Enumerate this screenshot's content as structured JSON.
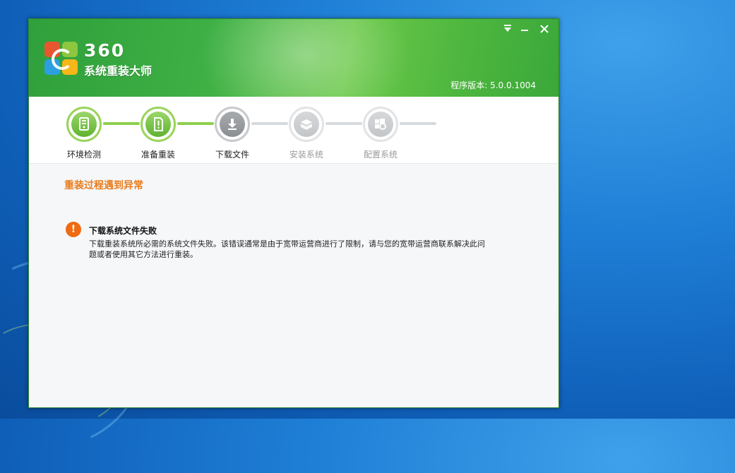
{
  "app": {
    "brand_number": "360",
    "brand_name": "系统重装大师",
    "version": "程序版本: 5.0.0.1004"
  },
  "window_controls": {
    "menu_icon": "dropdown-menu-icon",
    "minimize_icon": "minimize-icon",
    "close_icon": "close-icon"
  },
  "steps": [
    {
      "label": "环境检测",
      "icon": "computer-check-icon",
      "state": "done"
    },
    {
      "label": "准备重装",
      "icon": "prepare-icon",
      "state": "done"
    },
    {
      "label": "下载文件",
      "icon": "download-icon",
      "state": "current"
    },
    {
      "label": "安装系统",
      "icon": "install-box-icon",
      "state": "todo"
    },
    {
      "label": "配置系统",
      "icon": "windows-config-icon",
      "state": "todo"
    }
  ],
  "content": {
    "section_title": "重装过程遇到异常",
    "error": {
      "icon": "warning-icon",
      "title": "下载系统文件失败",
      "description": "下载重装系统所必需的系统文件失败。该错误通常是由于宽带运营商进行了限制，请与您的宽带运营商联系解决此问题或者使用其它方法进行重装。"
    }
  },
  "colors": {
    "header_green": "#3eb044",
    "step_done": "#8ccf4d",
    "title_orange": "#e87d1e",
    "error_orange": "#ef6a12"
  }
}
